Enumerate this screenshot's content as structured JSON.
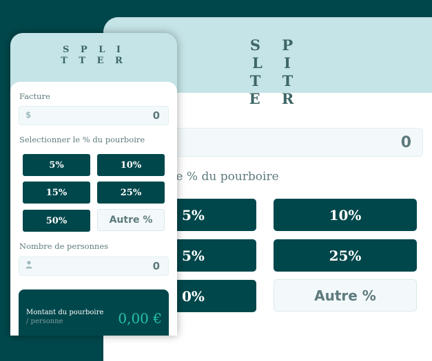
{
  "app": {
    "title_line1": "S P L I",
    "title_line2": "T T E R"
  },
  "bill": {
    "label": "Facture",
    "currency_symbol": "$",
    "value": "0"
  },
  "tip": {
    "label": "Selectionner le % du pourboire",
    "background_label_fragment": "le % du pourboire",
    "options": [
      "5%",
      "10%",
      "15%",
      "25%",
      "50%"
    ],
    "custom_label": "Autre %",
    "background_fragments": [
      "5%",
      "5%",
      "0%"
    ]
  },
  "people": {
    "label": "Nombre de personnes",
    "value": "0",
    "icon": "person-icon"
  },
  "result": {
    "tip_label": "Montant du pourboire",
    "per_person": "/ personne",
    "tip_amount": "0,00 €"
  },
  "colors": {
    "background": "#00474b",
    "header": "#c5e4e7",
    "accent": "#26c0ab",
    "text_muted": "#5e7a7d"
  }
}
